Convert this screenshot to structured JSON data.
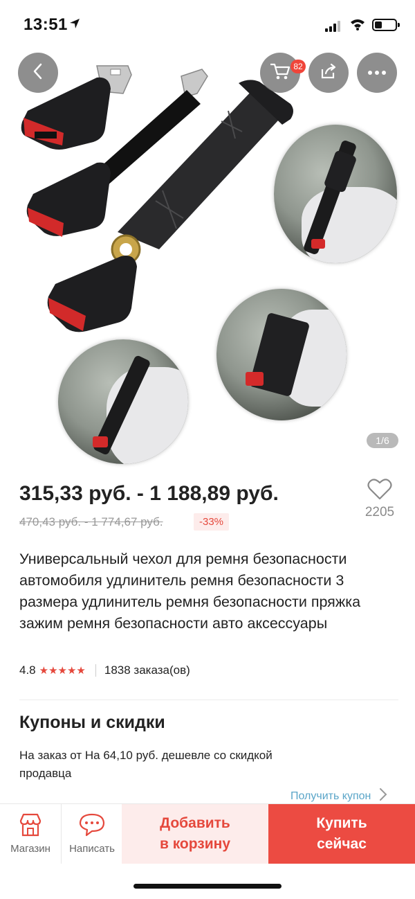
{
  "status_bar": {
    "time": "13:51"
  },
  "gallery": {
    "cart_badge": "82",
    "pager": "1/6",
    "icons": {
      "back": "chevron-left-icon",
      "cart": "cart-icon",
      "share": "share-icon",
      "more": "more-icon"
    }
  },
  "price": {
    "range": "315,33 руб. - 1 188,89 руб.",
    "old_range": "470,43 руб. - 1 774,67 руб.",
    "discount": "-33%"
  },
  "wishlist": {
    "count": "2205"
  },
  "product": {
    "title": "Универсальный чехол для ремня безопасности автомобиля удлинитель ремня безопасности 3 размера удлинитель ремня безопасности пряжка зажим ремня безопасности авто аксессуары",
    "rating": "4.8",
    "stars": "★★★★★",
    "orders": "1838 заказа(ов)"
  },
  "coupons": {
    "title": "Купоны и скидки",
    "text": "На заказ от На 64,10 руб. дешевле со скидкой продавца",
    "link": "Получить купон"
  },
  "bottom_bar": {
    "store_label": "Магазин",
    "message_label": "Написать",
    "add_to_cart": [
      "Добавить",
      "в корзину"
    ],
    "buy_now": [
      "Купить",
      "сейчас"
    ]
  },
  "colors": {
    "accent": "#ec4b42",
    "accent_light": "#fdeceb",
    "link": "#5aa5c8"
  }
}
